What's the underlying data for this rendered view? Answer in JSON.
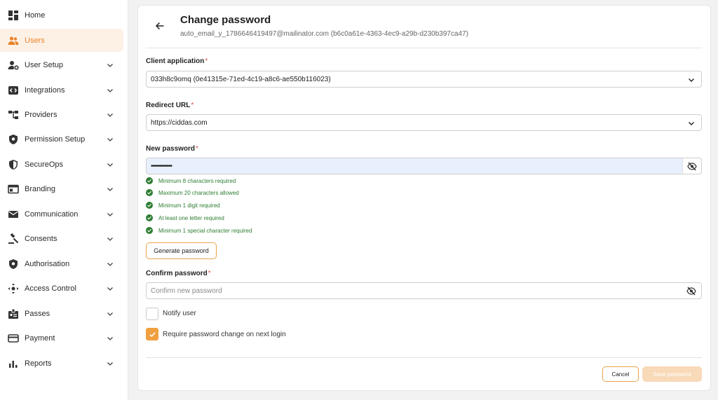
{
  "sidebar": {
    "items": [
      {
        "label": "Home",
        "icon": "dashboard-icon",
        "active": false
      },
      {
        "label": "Users",
        "icon": "users-icon",
        "active": true
      },
      {
        "label": "User Setup",
        "icon": "user-setup-icon",
        "active": false
      },
      {
        "label": "Integrations",
        "icon": "integrations-icon",
        "active": false
      },
      {
        "label": "Providers",
        "icon": "providers-icon",
        "active": false
      },
      {
        "label": "Permission Setup",
        "icon": "permission-shield-icon",
        "active": false
      },
      {
        "label": "SecureOps",
        "icon": "secureops-shield-icon",
        "active": false
      },
      {
        "label": "Branding",
        "icon": "branding-icon",
        "active": false
      },
      {
        "label": "Communication",
        "icon": "mail-icon",
        "active": false
      },
      {
        "label": "Consents",
        "icon": "gavel-icon",
        "active": false
      },
      {
        "label": "Authorisation",
        "icon": "authorisation-shield-icon",
        "active": false
      },
      {
        "label": "Access Control",
        "icon": "access-control-icon",
        "active": false
      },
      {
        "label": "Passes",
        "icon": "badge-icon",
        "active": false
      },
      {
        "label": "Payment",
        "icon": "credit-card-icon",
        "active": false
      },
      {
        "label": "Reports",
        "icon": "bar-chart-icon",
        "active": false
      }
    ]
  },
  "header": {
    "title": "Change password",
    "subtitle": "auto_email_y_1786646419497@mailinator.com (b6c0a61e-4363-4ec9-a29b-d230b397ca47)"
  },
  "form": {
    "client_app": {
      "label": "Client application",
      "required_mark": "*",
      "value": "033h8c9omq (0e41315e-71ed-4c19-a8c6-ae550b116023)"
    },
    "redirect_url": {
      "label": "Redirect URL",
      "required_mark": "*",
      "value": "https://ciddas.com"
    },
    "new_password": {
      "label": "New password",
      "required_mark": "*",
      "value": "••••••••••••"
    },
    "rules": [
      "Minimum 8 characters required",
      "Maximum 20 characters allowed",
      "Minimum 1 digit required",
      "At least one letter required",
      "Minimum 1 special character required"
    ],
    "generate_label": "Generate password",
    "confirm_password": {
      "label": "Confirm password",
      "required_mark": "*",
      "placeholder": "Confirm new password"
    },
    "notify_user": {
      "label": "Notify user",
      "checked": false
    },
    "require_change": {
      "label": "Require password change on next login",
      "checked": true
    }
  },
  "actions": {
    "cancel_label": "Cancel",
    "save_label": "Save password"
  },
  "colors": {
    "accent": "#f0a040",
    "active_bg": "#fdf1e6",
    "success": "#2e7d32",
    "required": "#d9534f"
  }
}
